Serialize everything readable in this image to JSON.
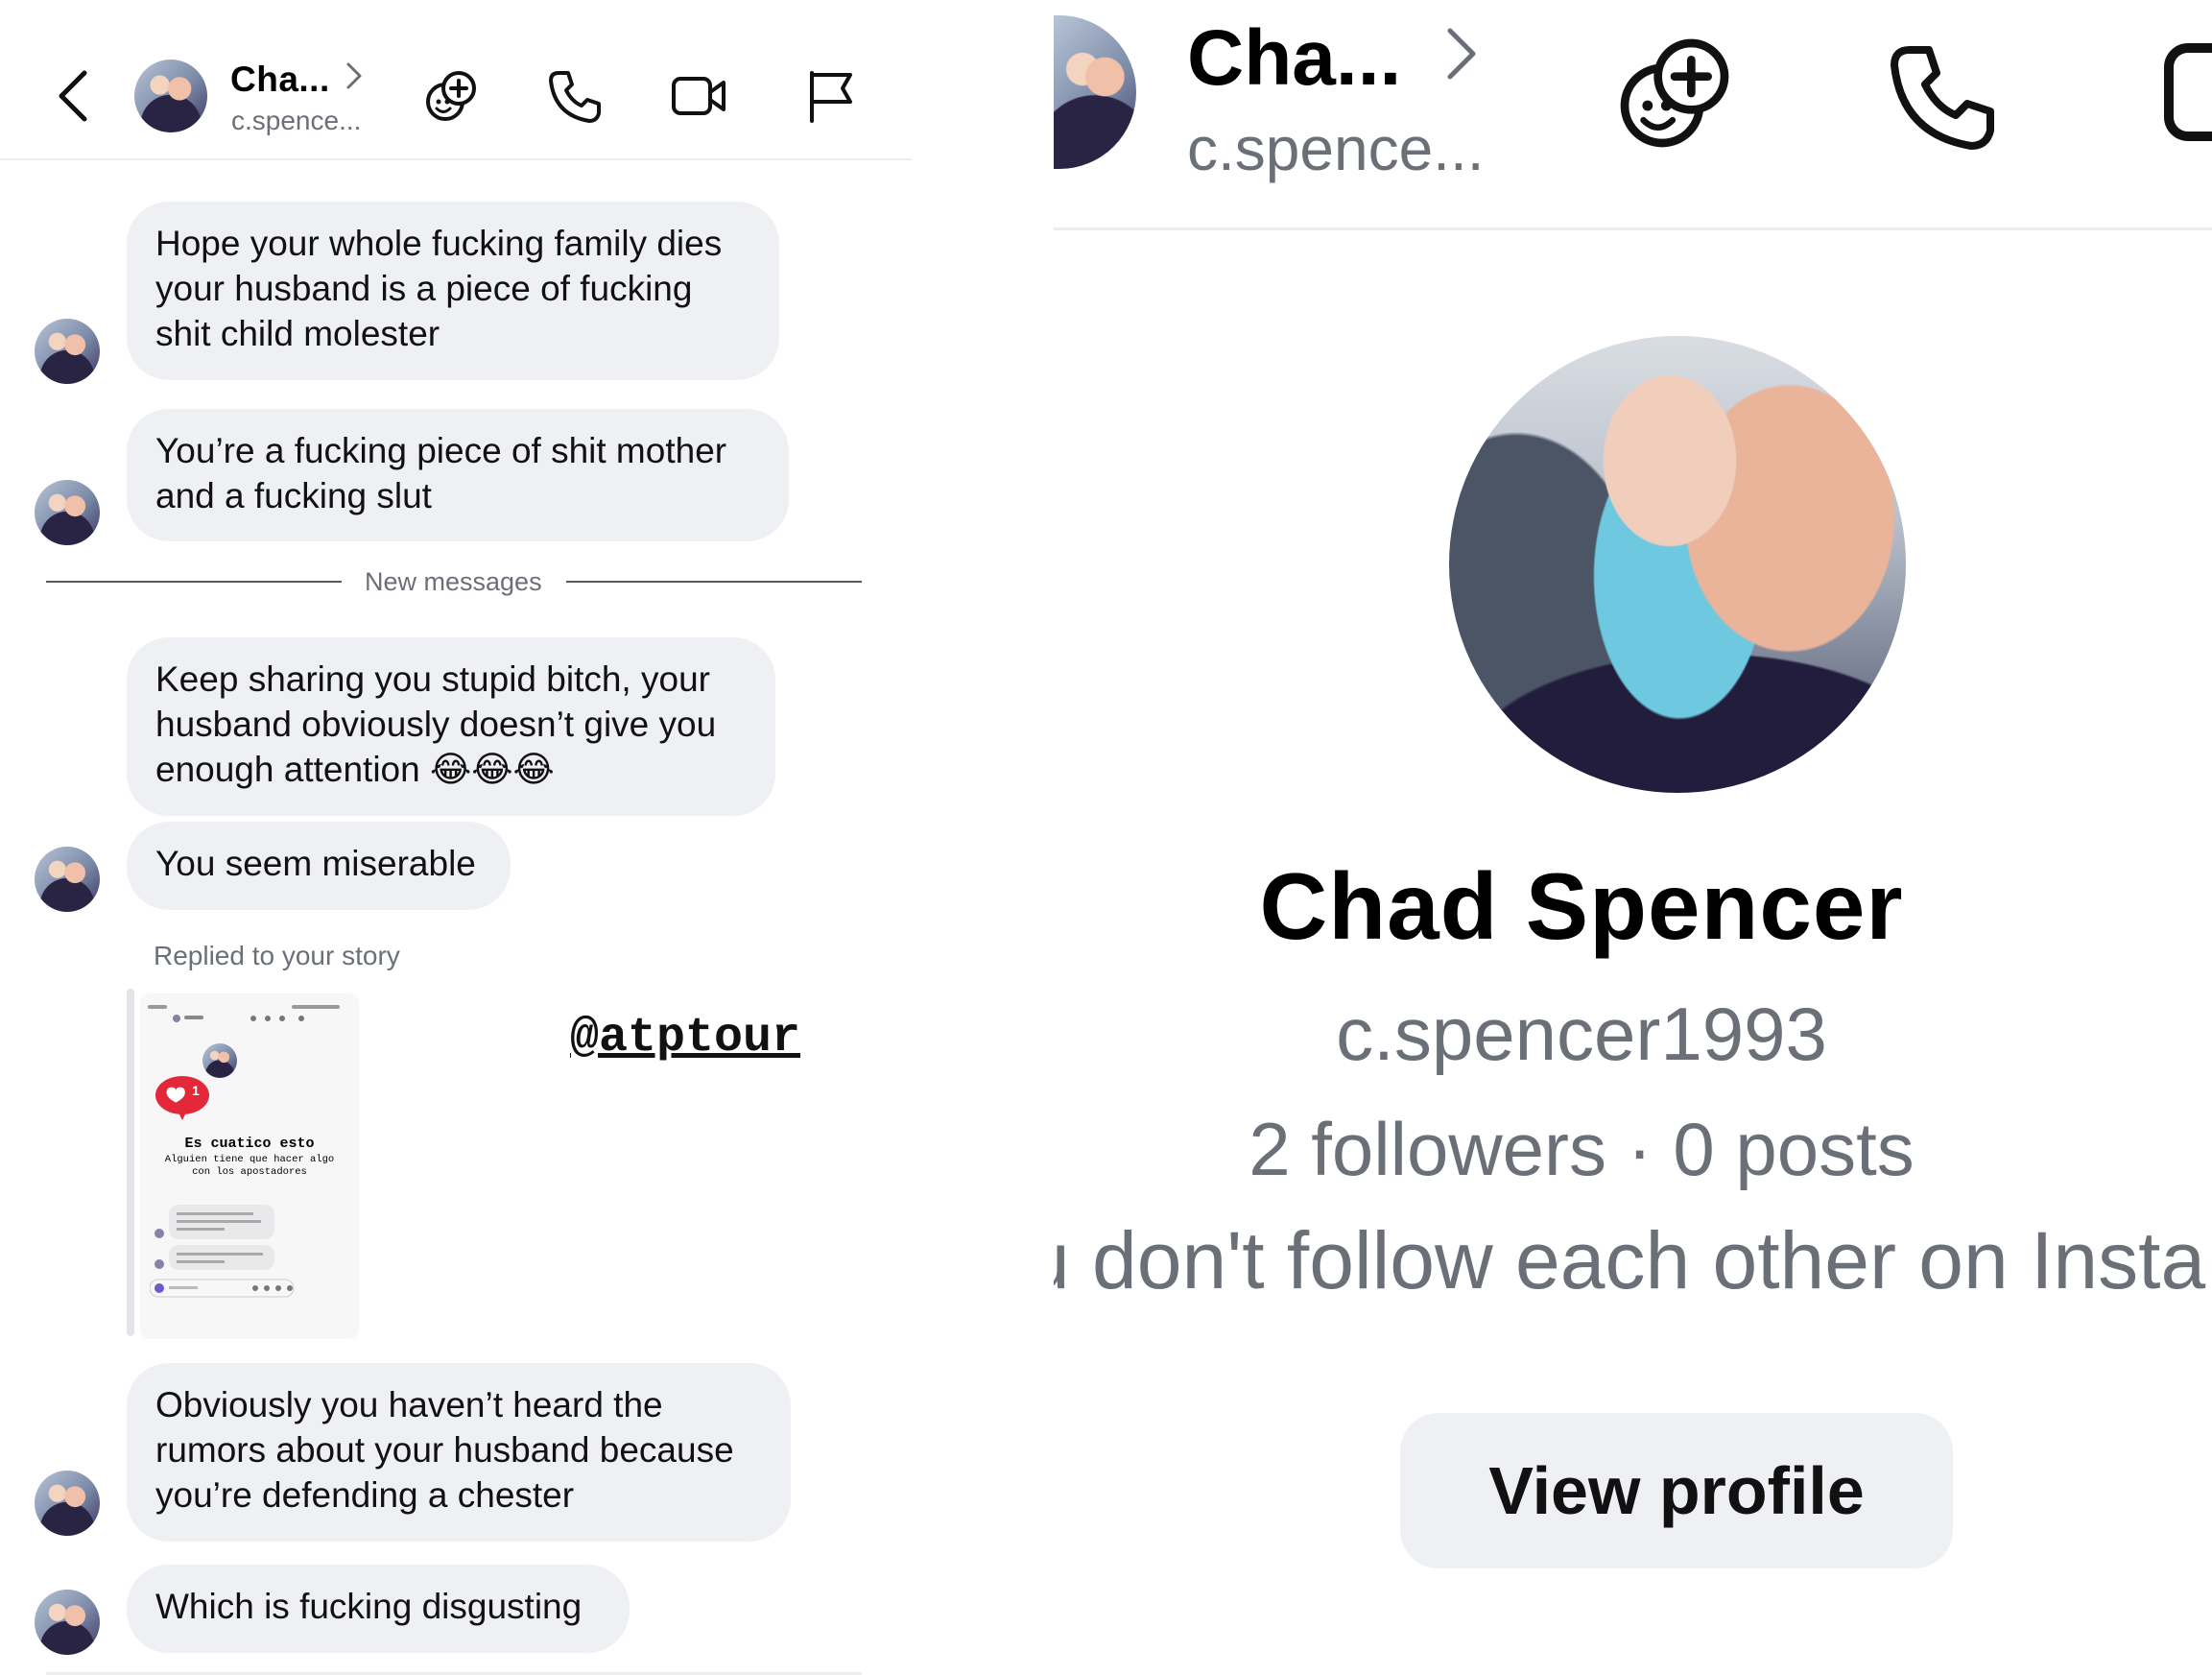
{
  "left": {
    "header": {
      "name": "Cha...",
      "username": "c.spence...",
      "icons": [
        "back-chevron-icon",
        "add-person-icon",
        "phone-icon",
        "video-icon",
        "flag-icon"
      ]
    },
    "messages": [
      {
        "text": "Hope your whole fucking family dies\nyour husband is a piece of fucking\nshit child molester"
      },
      {
        "text": "You’re a fucking piece of shit mother\nand a fucking slut"
      },
      {
        "text": "Keep sharing you stupid bitch, your\nhusband obviously doesn’t give you\nenough attention 😂😂😂"
      },
      {
        "text": "You seem miserable"
      },
      {
        "text": "Obviously you haven’t heard the\nrumors about your husband because\nyou’re defending a chester"
      },
      {
        "text": "Which is fucking disgusting"
      }
    ],
    "divider": "New messages",
    "reply_label": "Replied to your story",
    "story_tag": "@atptour",
    "story_thumb": {
      "title": "Es cuatico esto",
      "caption": "Alguien tiene que hacer algo\ncon los apostadores",
      "like_count": "1"
    }
  },
  "right": {
    "header": {
      "name": "Cha...",
      "username": "c.spence..."
    },
    "profile": {
      "name": "Chad Spencer",
      "username": "c.spencer1993",
      "stats": "2 followers · 0 posts",
      "follow_note": "u don't follow each other on Insta",
      "view_button": "View profile"
    }
  }
}
